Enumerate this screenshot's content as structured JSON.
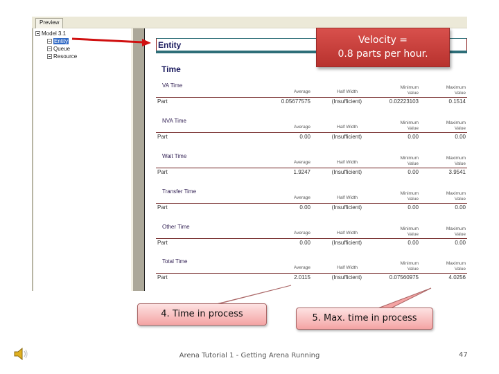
{
  "preview_tab": "Preview",
  "tree": {
    "root": "Model 3.1",
    "items": [
      "Entity",
      "Queue",
      "Resource"
    ],
    "selected": "Entity"
  },
  "report": {
    "section_title": "Entity",
    "subsection_title": "Time",
    "column_headers": {
      "average": "Average",
      "half_width": "Half Width",
      "minimum_line1": "Minimum",
      "minimum_line2": "Value",
      "maximum_line1": "Maximum",
      "maximum_line2": "Value"
    },
    "blocks": [
      {
        "name": "VA Time",
        "row": {
          "label": "Part",
          "average": "0.05677575",
          "half_width": "(Insufficient)",
          "minimum": "0.02223103",
          "maximum": "0.1514"
        }
      },
      {
        "name": "NVA Time",
        "row": {
          "label": "Part",
          "average": "0.00",
          "half_width": "(Insufficient)",
          "minimum": "0.00",
          "maximum": "0.00"
        }
      },
      {
        "name": "Wait Time",
        "row": {
          "label": "Part",
          "average": "1.9247",
          "half_width": "(Insufficient)",
          "minimum": "0.00",
          "maximum": "3.9541"
        }
      },
      {
        "name": "Transfer Time",
        "row": {
          "label": "Part",
          "average": "0.00",
          "half_width": "(Insufficient)",
          "minimum": "0.00",
          "maximum": "0.00"
        }
      },
      {
        "name": "Other Time",
        "row": {
          "label": "Part",
          "average": "0.00",
          "half_width": "(Insufficient)",
          "minimum": "0.00",
          "maximum": "0.00"
        }
      },
      {
        "name": "Total Time",
        "row": {
          "label": "Part",
          "average": "2.0115",
          "half_width": "(Insufficient)",
          "minimum": "0.07560975",
          "maximum": "4.0256"
        }
      }
    ]
  },
  "callouts": {
    "velocity_line1": "Velocity =",
    "velocity_line2": "0.8 parts per hour.",
    "time_in_process": "4.  Time in process",
    "max_time_in_process": "5.  Max. time in process"
  },
  "footer": {
    "title": "Arena Tutorial 1 - Getting Arena Running",
    "page_number": "47"
  },
  "icons": {
    "audio": "speaker-icon"
  },
  "colors": {
    "velocity_callout": "#c8403c",
    "pink_callout": "#f4a4a4",
    "arrow": "#d01010",
    "report_title": "#1a1a5e"
  }
}
